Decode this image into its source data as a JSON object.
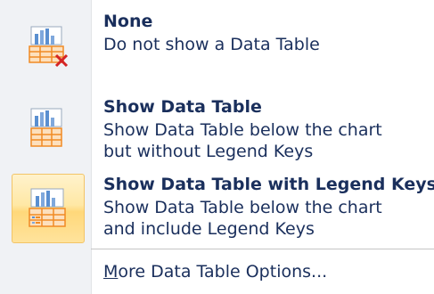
{
  "menu": {
    "items": [
      {
        "title": "None",
        "desc_line1": "Do not show a Data Table",
        "desc_line2": "",
        "icon": "data-table-none-icon",
        "selected": false
      },
      {
        "title": "Show Data Table",
        "desc_line1": "Show Data Table below the chart",
        "desc_line2": "but without Legend Keys",
        "icon": "data-table-icon",
        "selected": false
      },
      {
        "title": "Show Data Table with Legend Keys",
        "desc_line1": "Show Data Table below the chart",
        "desc_line2": "and include Legend Keys",
        "icon": "data-table-legend-keys-icon",
        "selected": true
      }
    ],
    "more_accel": "M",
    "more_rest": "ore Data Table Options..."
  },
  "colors": {
    "text": "#1a2f5c",
    "highlight_border": "#f2c467",
    "highlight_fill": "#ffe8a5",
    "icon_orange": "#f08a24",
    "icon_blue": "#5a8fd0",
    "delete_red": "#d42424"
  }
}
